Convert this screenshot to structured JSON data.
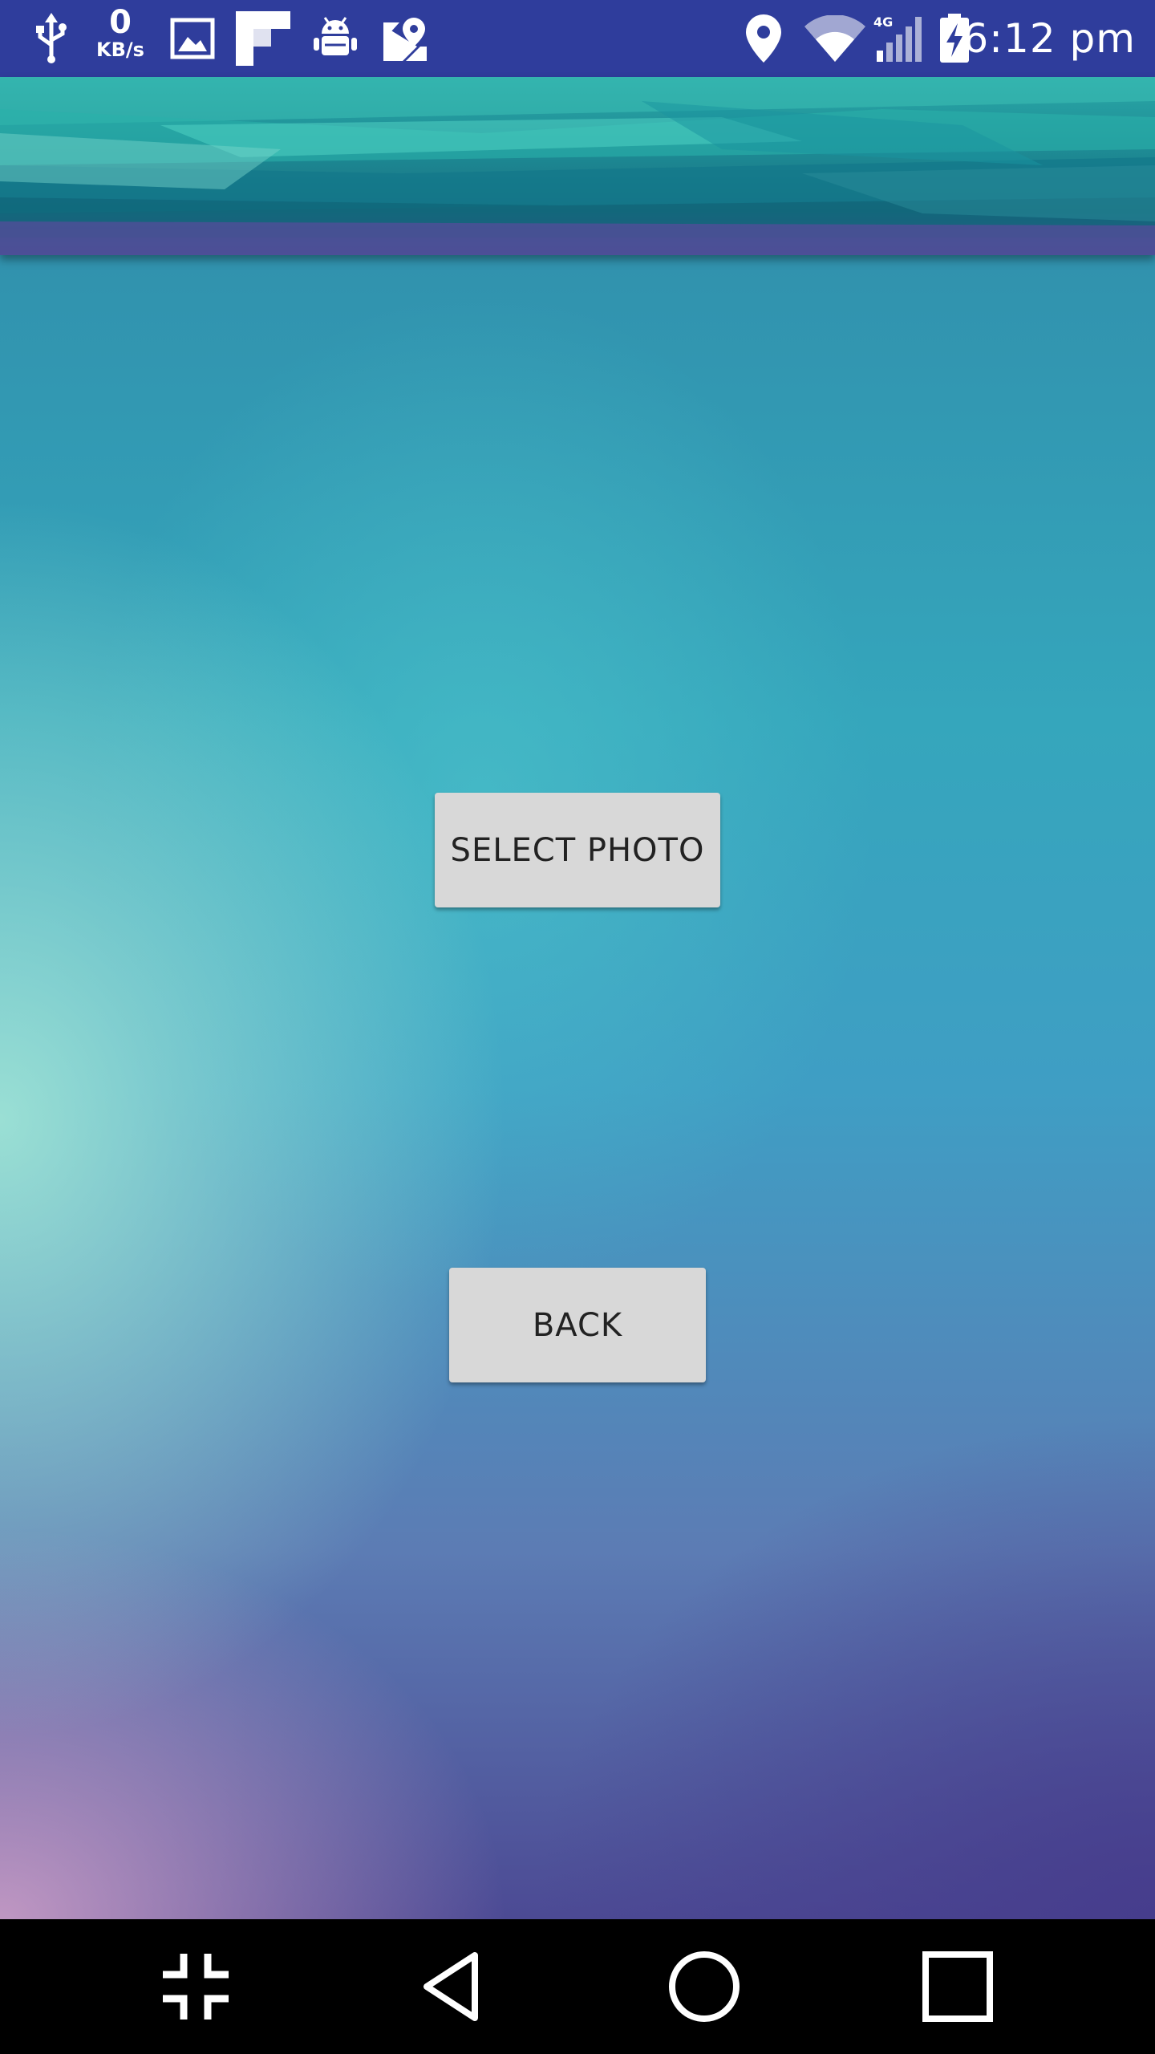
{
  "status_bar": {
    "data_rate_value": "0",
    "data_rate_unit": "KB/s",
    "network_type": "4G",
    "time": "6:12 pm",
    "icons": [
      "usb-icon",
      "image-icon",
      "flipboard-icon",
      "android-debug-icon",
      "maps-icon",
      "location-icon",
      "wifi-icon",
      "signal-icon",
      "battery-charging-icon"
    ]
  },
  "main": {
    "select_photo_label": "SELECT PHOTO",
    "back_label": "BACK"
  },
  "nav_bar": {
    "icons": [
      "collapse-icon",
      "back-icon",
      "home-icon",
      "recents-icon"
    ]
  },
  "colors": {
    "status_bar": "#2f3d9c",
    "button_bg": "#d8d8d8",
    "button_text": "#222222",
    "nav_bar": "#000000"
  }
}
